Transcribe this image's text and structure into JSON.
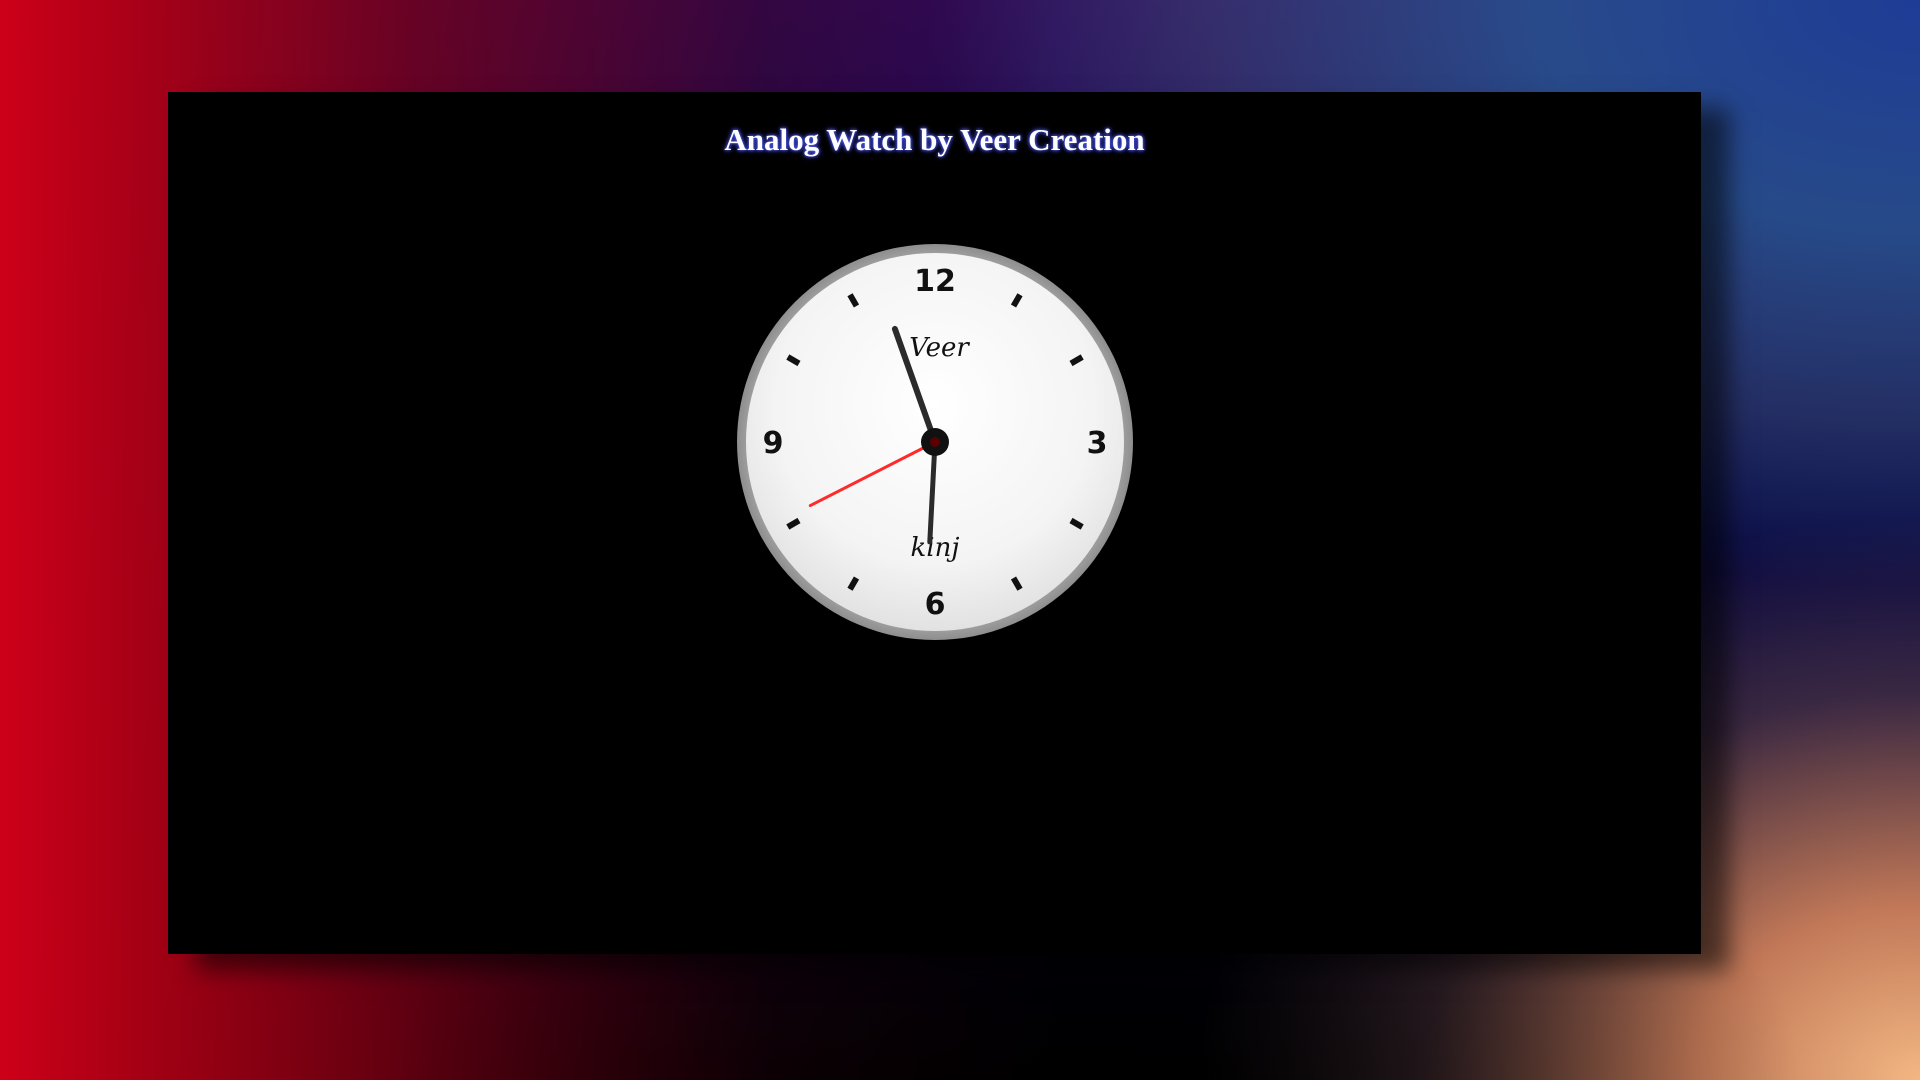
{
  "page": {
    "title": "Analog Watch by Veer Creation"
  },
  "clock": {
    "numerals": {
      "twelve": "12",
      "three": "3",
      "six": "6",
      "nine": "9"
    },
    "brand_top": "Veer",
    "brand_bottom": "kinj",
    "time": {
      "hour": 11,
      "minute": 30,
      "second": 40
    },
    "colors": {
      "hand": "#2b2b2b",
      "second_hand": "#ff2a2a",
      "bezel": "#9a9a9a",
      "face": "#f4f4f4"
    }
  }
}
